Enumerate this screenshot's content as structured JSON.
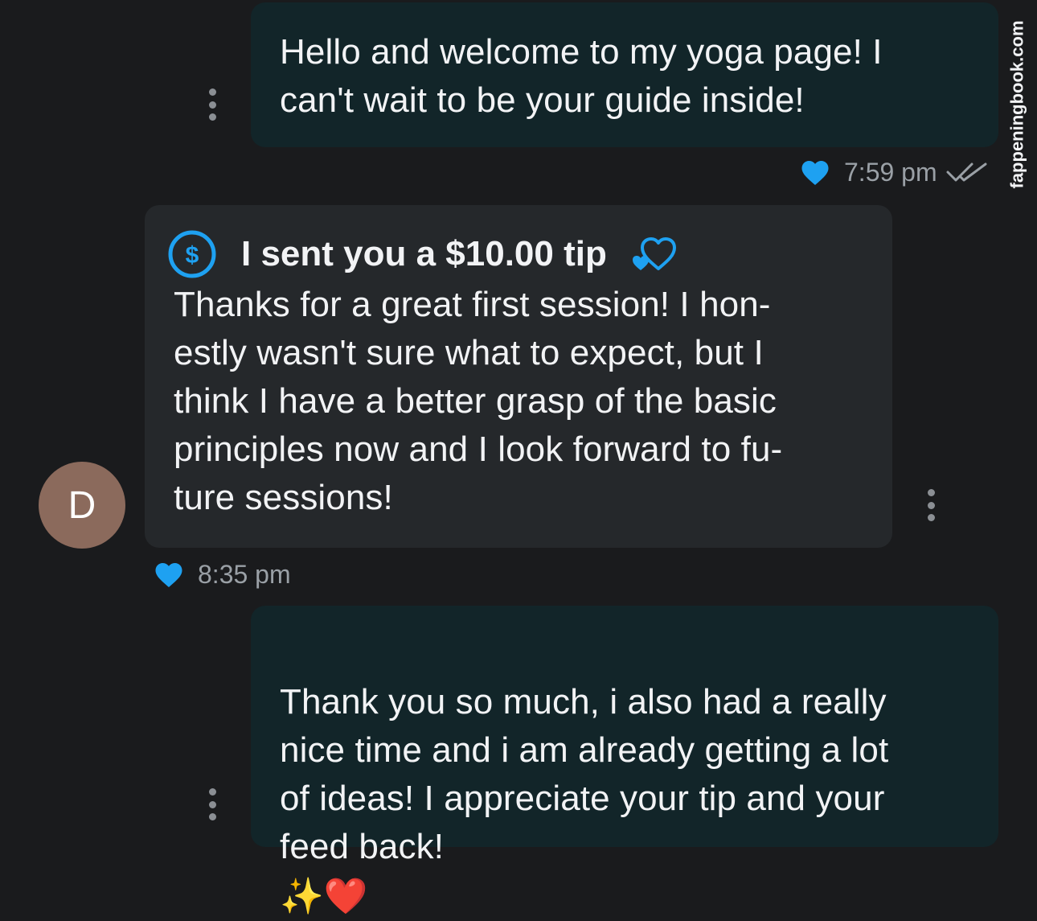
{
  "watermark": "fappeningbook.com",
  "colors": {
    "background": "#1a1b1d",
    "outgoing_bubble": "#122529",
    "incoming_bubble": "#25282b",
    "accent_blue": "#1ea1f1",
    "avatar": "#8b6a5c",
    "timestamp": "#9aa0a6"
  },
  "messages": [
    {
      "direction": "outgoing",
      "text": "Hello and welcome to my yoga page! I\ncan't wait to be your guide inside!",
      "time": "7:59 pm",
      "liked": true,
      "read_receipt": "double-check-icon"
    },
    {
      "direction": "incoming",
      "avatar_initial": "D",
      "tip_label": "I sent you a $10.00 tip",
      "text": "Thanks for a great first session! I hon-\nestly wasn't sure what to expect, but I\nthink I have a better grasp of the basic\nprinciples now and I look forward to fu-\nture sessions!",
      "time": "8:35 pm",
      "liked": true
    },
    {
      "direction": "outgoing",
      "text": "Thank you so much, i also had a really\nnice time and i am already getting a lot\nof ideas! I appreciate your tip and your\nfeed back!",
      "emoji": "✨❤️"
    }
  ]
}
